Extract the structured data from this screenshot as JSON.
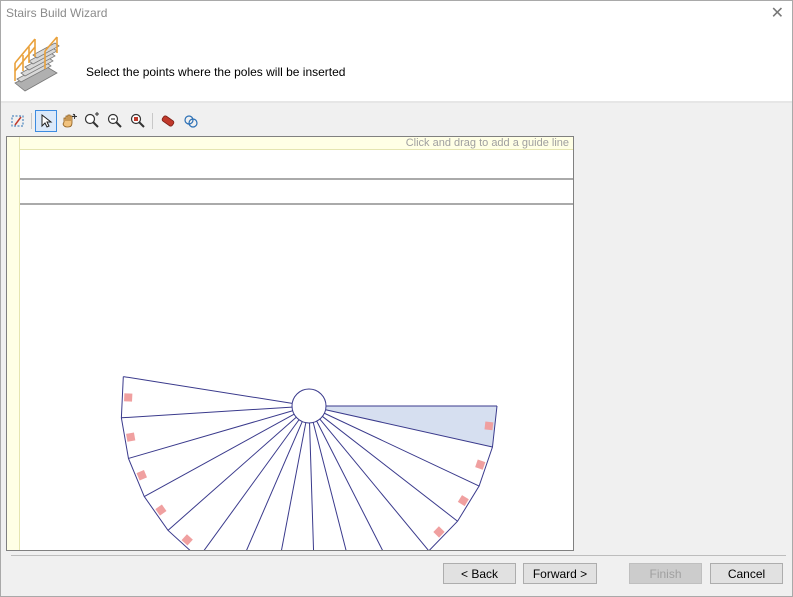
{
  "window": {
    "title": "Stairs Build Wizard"
  },
  "header": {
    "instruction": "Select the points where the poles will be inserted"
  },
  "canvas": {
    "guide_hint": "Click and drag to add a guide line"
  },
  "toolbar": {
    "tools": [
      {
        "name": "select-region-tool-icon",
        "active": false
      },
      {
        "name": "pointer-tool-icon",
        "active": true
      },
      {
        "name": "pan-hand-tool-icon",
        "active": false
      },
      {
        "name": "zoom-in-tool-icon",
        "active": false
      },
      {
        "name": "zoom-out-tool-icon",
        "active": false
      },
      {
        "name": "zoom-fit-tool-icon",
        "active": false
      },
      {
        "name": "eraser-tool-icon",
        "active": false
      },
      {
        "name": "link-objects-tool-icon",
        "active": false
      }
    ]
  },
  "drawing": {
    "step_count": 15,
    "selected_step": 15,
    "colors": {
      "outline": "#3a3a8c",
      "selected_fill": "#d6dff0",
      "pole_marker": "#f0a0a0"
    }
  },
  "buttons": {
    "back": "< Back",
    "forward": "Forward >",
    "finish": "Finish",
    "cancel": "Cancel"
  }
}
